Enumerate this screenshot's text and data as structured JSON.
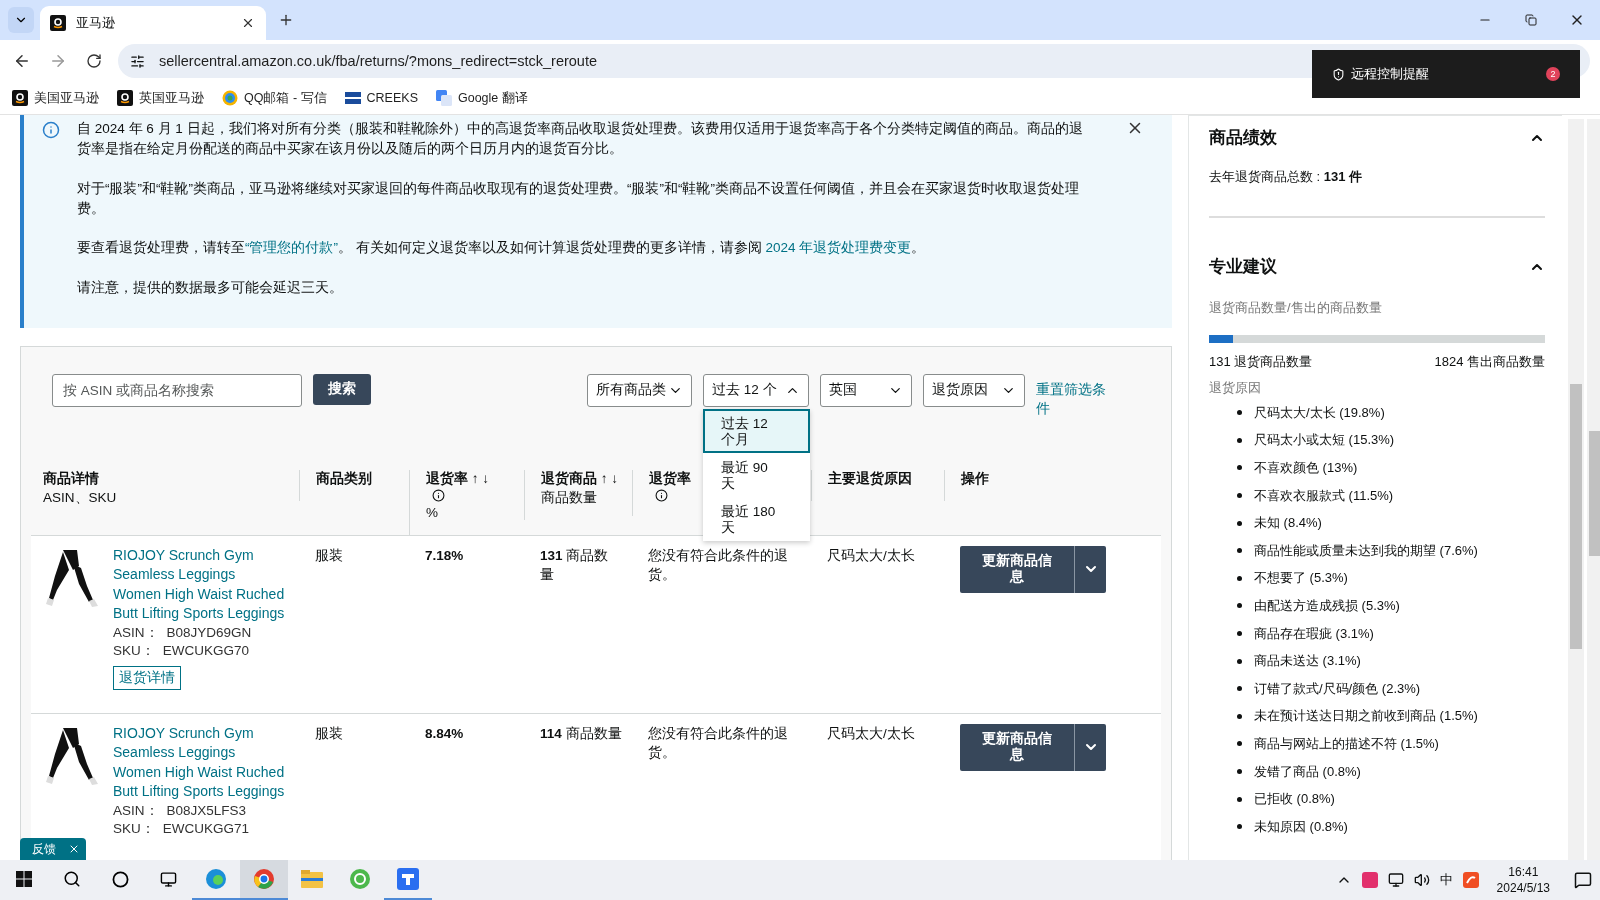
{
  "browser": {
    "tab": {
      "title": "亚马逊"
    },
    "url": "sellercentral.amazon.co.uk/fba/returns/?mons_redirect=stck_reroute",
    "bookmarks": [
      {
        "label": "美国亚马逊",
        "kind": "amazon"
      },
      {
        "label": "英国亚马逊",
        "kind": "amazon"
      },
      {
        "label": "QQ邮箱 - 写信",
        "kind": "mail"
      },
      {
        "label": "CREEKS",
        "kind": "flag"
      },
      {
        "label": "Google 翻译",
        "kind": "translate"
      }
    ]
  },
  "notification": {
    "text": "远程控制提醒",
    "count": "2"
  },
  "banner": {
    "paragraphs": [
      [
        {
          "text": "自 2024 年 6 月 1 日起，我们将对所有分类（服装和鞋靴除外）中的高退货率商品收取退货处理费。该费用仅适用于退货率高于各个分类特定阈值的商品。商品的退货率是指在给定月份配送的商品中买家在该月份以及随后的两个日历月内的退货百分比。",
          "link": false
        }
      ],
      [
        {
          "text": "对于“服装”和“鞋靴”类商品，亚马逊将继续对买家退回的每件商品收取现有的退货处理费。“服装”和“鞋靴”类商品不设置任何阈值，并且会在买家退货时收取退货处理费。",
          "link": false
        }
      ],
      [
        {
          "text": "要查看退货处理费，请转至",
          "link": false
        },
        {
          "text": "“管理您的付款”",
          "link": true
        },
        {
          "text": "。 有关如何定义退货率以及如何计算退货处理费的更多详情，请参阅 ",
          "link": false
        },
        {
          "text": "2024 年退货处理费变更",
          "link": true
        },
        {
          "text": "。",
          "link": false
        }
      ],
      [
        {
          "text": "请注意，提供的数据最多可能会延迟三天。",
          "link": false
        }
      ]
    ]
  },
  "filters": {
    "search": {
      "placeholder": "按 ASIN 或商品名称搜索"
    },
    "search_button": "搜索",
    "dropdowns": [
      {
        "label": "所有商品类",
        "expanded": false
      },
      {
        "label": "过去 12 个",
        "expanded": true
      },
      {
        "label": "英国",
        "expanded": false
      },
      {
        "label": "退货原因",
        "expanded": false
      }
    ],
    "reset": "重置筛选条件",
    "menu_options": [
      {
        "label": "过去 12 个月",
        "selected": true
      },
      {
        "label": "最近 90 天",
        "selected": false
      },
      {
        "label": "最近 180 天",
        "selected": false
      }
    ]
  },
  "table": {
    "columns": [
      {
        "title": "商品详情",
        "info": false,
        "sub": "ASIN、SKU"
      },
      {
        "title": "商品类别",
        "info": false
      },
      {
        "title": "退货率 ↑ ↓",
        "info": true,
        "sub": "%"
      },
      {
        "title": "退货商品 ↑ ↓",
        "info": false,
        "sub": "商品数量"
      },
      {
        "title": "退货率",
        "info": true
      },
      {
        "title": "主要退货原因",
        "info": false
      },
      {
        "title": "操作",
        "info": false
      }
    ],
    "rows": [
      {
        "title": "RIOJOY Scrunch Gym Seamless Leggings Women High Waist Ruched Butt Lifting Sports Leggings",
        "asin_label": "ASIN：",
        "asin": "B08JYD69GN",
        "sku_label": "SKU：",
        "sku": "EWCUKGG70",
        "details": "退货详情",
        "category": "服装",
        "rate": "7.18%",
        "units": "**131** 商品数量",
        "note": "您没有符合此条件的退货。",
        "reason": "尺码太大/太长",
        "action": "更新商品信息"
      },
      {
        "title": "RIOJOY Scrunch Gym Seamless Leggings Women High Waist Ruched Butt Lifting Sports Leggings",
        "asin_label": "ASIN：",
        "asin": "B08JX5LFS3",
        "sku_label": "SKU：",
        "sku": "EWCUKGG71",
        "category": "服装",
        "rate": "8.84%",
        "units": "**114** 商品数量",
        "note": "您没有符合此条件的退货。",
        "reason": "尺码太大/太长",
        "action": "更新商品信息"
      }
    ]
  },
  "feedback": {
    "label": "反馈"
  },
  "sidebar": {
    "performance": {
      "title": "商品绩效",
      "expanded": true,
      "summary": "去年退货商品总数 : **131 件**"
    },
    "advice": {
      "title": "专业建议",
      "expanded": true,
      "ratio_label": "退货商品数量/售出的商品数量",
      "level": 0.072,
      "returned": "131 退货商品数量",
      "sold": "1824 售出商品数量",
      "reasons_title": "退货原因",
      "reasons": [
        "尺码太大/太长 (19.8%)",
        "尺码太小或太短 (15.3%)",
        "不喜欢颜色 (13%)",
        "不喜欢衣服款式 (11.5%)",
        "未知 (8.4%)",
        "商品性能或质量未达到我的期望 (7.6%)",
        "不想要了 (5.3%)",
        "由配送方造成残损 (5.3%)",
        "商品存在瑕疵 (3.1%)",
        "商品未送达 (3.1%)",
        "订错了款式/尺码/颜色 (2.3%)",
        "未在预计送达日期之前收到商品 (1.5%)",
        "商品与网站上的描述不符 (1.5%)",
        "发错了商品 (0.8%)",
        "已拒收 (0.8%)",
        "未知原因 (0.8%)"
      ]
    }
  },
  "taskbar": {
    "ime": "中",
    "time": "16:41",
    "date": "2024/5/13"
  }
}
